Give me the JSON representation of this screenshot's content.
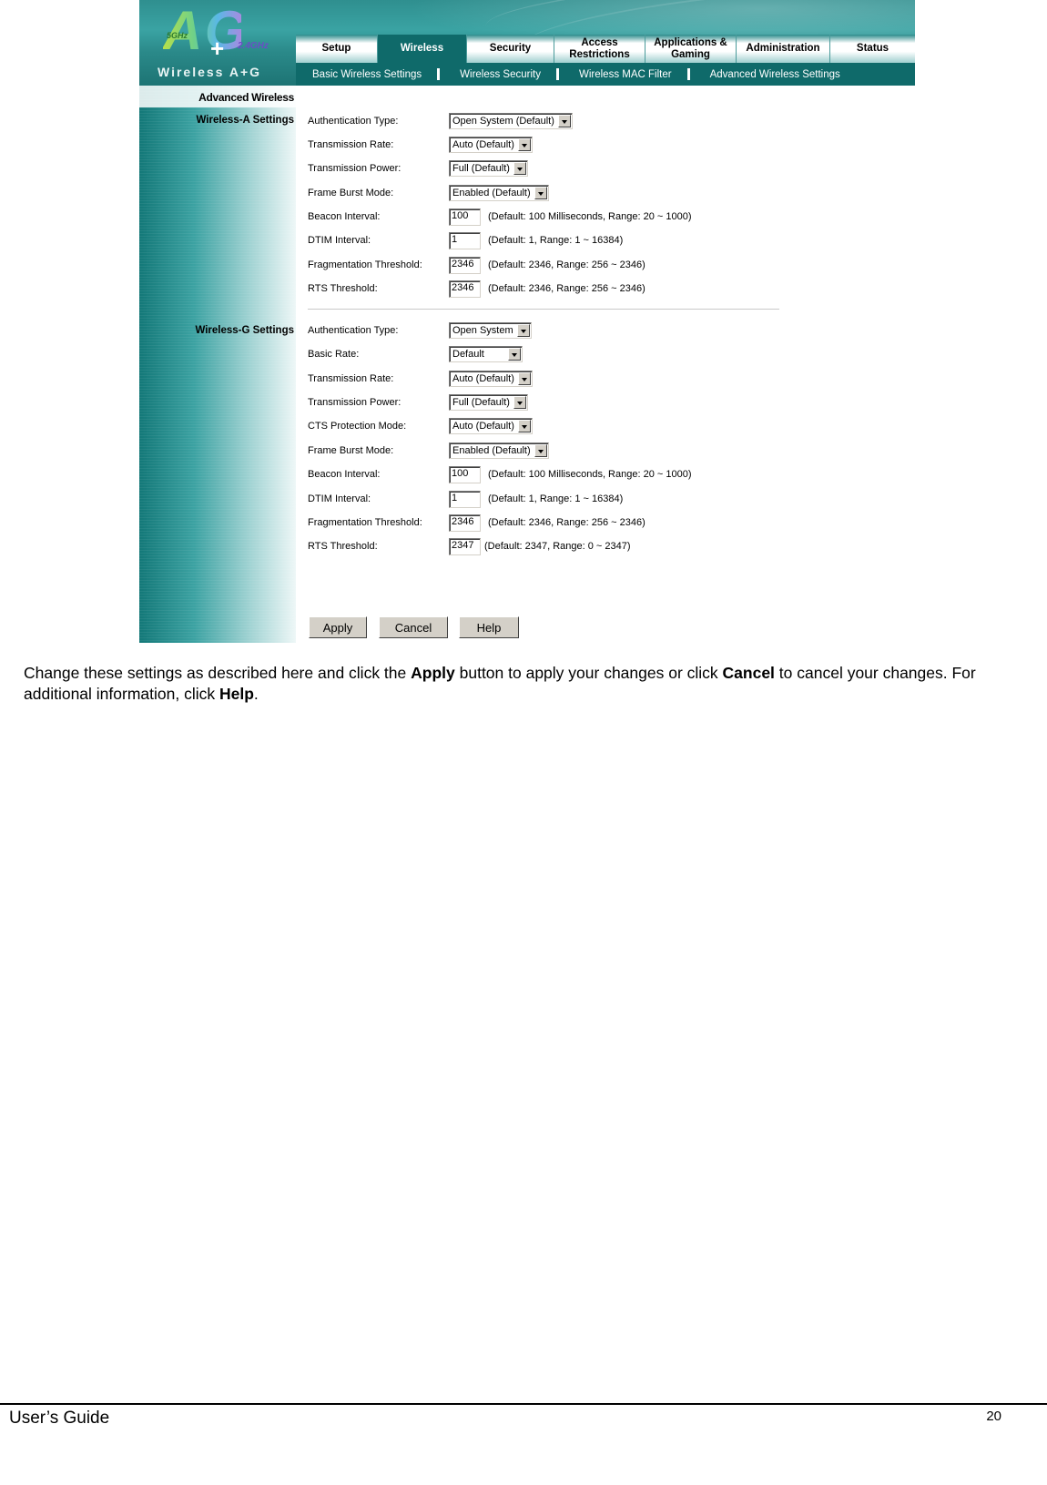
{
  "router_ui": {
    "logo": {
      "big_text": "A G",
      "band_5": "5GHz",
      "plus": "+",
      "band_24": "2.4GHz",
      "product_name": "Wireless A+G"
    },
    "tabs": [
      {
        "label": "Setup",
        "active": false
      },
      {
        "label": "Wireless",
        "active": true
      },
      {
        "label": "Security",
        "active": false
      },
      {
        "label": "Access Restrictions",
        "active": false
      },
      {
        "label": "Applications & Gaming",
        "active": false
      },
      {
        "label": "Administration",
        "active": false
      },
      {
        "label": "Status",
        "active": false
      }
    ],
    "subnav": [
      "Basic Wireless Settings",
      "Wireless Security",
      "Wireless MAC Filter",
      "Advanced Wireless Settings"
    ],
    "page_heading": "Advanced Wireless",
    "wireless_a": {
      "title": "Wireless-A Settings",
      "fields": [
        {
          "label": "Authentication Type:",
          "type": "select",
          "value": "Open System (Default)"
        },
        {
          "label": "Transmission Rate:",
          "type": "select",
          "value": "Auto (Default)"
        },
        {
          "label": "Transmission Power:",
          "type": "select",
          "value": "Full (Default)"
        },
        {
          "label": "Frame Burst Mode:",
          "type": "select",
          "value": "Enabled (Default)"
        },
        {
          "label": "Beacon Interval:",
          "type": "input",
          "value": "100",
          "hint": "(Default: 100 Milliseconds, Range: 20 ~ 1000)"
        },
        {
          "label": "DTIM Interval:",
          "type": "input",
          "value": "1",
          "hint": "(Default: 1, Range: 1 ~ 16384)"
        },
        {
          "label": "Fragmentation Threshold:",
          "type": "input",
          "value": "2346",
          "hint": "(Default: 2346, Range: 256 ~ 2346)"
        },
        {
          "label": "RTS Threshold:",
          "type": "input",
          "value": "2346",
          "hint": "(Default: 2346, Range: 256 ~ 2346)"
        }
      ]
    },
    "wireless_g": {
      "title": "Wireless-G Settings",
      "fields": [
        {
          "label": "Authentication Type:",
          "type": "select",
          "value": "Open System"
        },
        {
          "label": "Basic Rate:",
          "type": "select",
          "value": "Default"
        },
        {
          "label": "Transmission Rate:",
          "type": "select",
          "value": "Auto (Default)"
        },
        {
          "label": "Transmission Power:",
          "type": "select",
          "value": "Full (Default)"
        },
        {
          "label": "CTS Protection Mode:",
          "type": "select",
          "value": "Auto (Default)"
        },
        {
          "label": "Frame Burst Mode:",
          "type": "select",
          "value": "Enabled (Default)"
        },
        {
          "label": "Beacon Interval:",
          "type": "input",
          "value": "100",
          "hint": "(Default: 100 Milliseconds, Range: 20 ~ 1000)"
        },
        {
          "label": "DTIM Interval:",
          "type": "input",
          "value": "1",
          "hint": "(Default: 1, Range: 1 ~ 16384)"
        },
        {
          "label": "Fragmentation Threshold:",
          "type": "input",
          "value": "2346",
          "hint": "(Default: 2346, Range: 256 ~ 2346)"
        },
        {
          "label": "RTS Threshold:",
          "type": "input",
          "value": "2347",
          "hint": "(Default: 2347, Range: 0 ~ 2347)"
        }
      ]
    },
    "buttons": {
      "apply": "Apply",
      "cancel": "Cancel",
      "help": "Help"
    }
  },
  "document": {
    "paragraph": {
      "t1": "Change these settings as described here and click the ",
      "b1": "Apply",
      "t2": " button to apply your changes or click ",
      "b2": "Cancel",
      "t3": " to cancel your changes. For additional information, click ",
      "b3": "Help",
      "t4": "."
    },
    "footer": {
      "left": "User’s Guide",
      "page_number": "20"
    }
  },
  "colors": {
    "teal_dark": "#0f6a6a",
    "teal": "#2b8a8a",
    "button_face": "#d4d0c8"
  }
}
